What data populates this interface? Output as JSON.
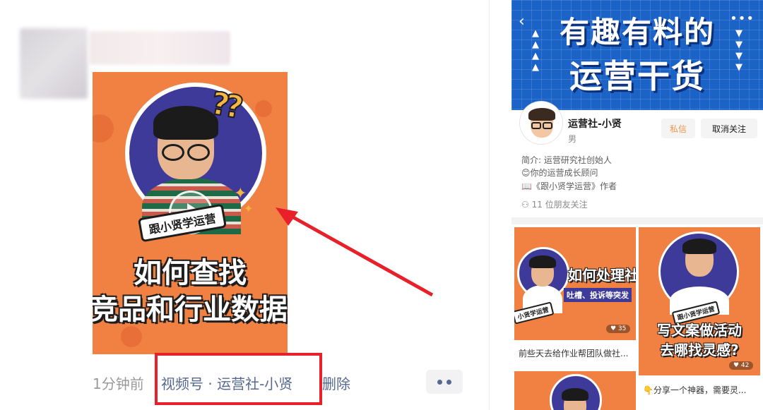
{
  "post": {
    "time": "1分钟前",
    "source": "视频号 · 运营社-小贤",
    "delete": "删除",
    "cover_tag": "跟小贤学运营",
    "cover_title_1": "如何查找",
    "cover_title_2": "竞品和行业数据",
    "cover_qmarks": "??"
  },
  "profile": {
    "banner_line_1": "有趣有料的",
    "banner_line_2": "运营干货",
    "name": "运营社-小贤",
    "gender": "男",
    "message_btn": "私信",
    "unfollow_btn": "取消关注",
    "bio_1": "简介: 运营研究社创始人",
    "bio_2": "😊你的运营成长顾问",
    "bio_3": "📖《跟小贤学运营》作者",
    "friends": "11 位朋友关注"
  },
  "grid": [
    {
      "title": "如何处理社",
      "subtitle": "吐槽、投诉等突发",
      "tag": "小贤学运营",
      "likes": "♥ 35",
      "caption": "前些天去给作业帮团队做社..."
    },
    {
      "title_1": "写文案做活动",
      "title_2": "去哪找灵感?",
      "tag": "跟小贤学运营",
      "likes": "♥ 42",
      "caption": "👇分享一个神器，需要灵..."
    }
  ],
  "colors": {
    "cover_orange": "#f08142",
    "circle_blue": "#3e3a9a",
    "banner_blue": "#1c63c8",
    "link_blue": "#57688f",
    "highlight_red": "#e8202a",
    "message_orange": "#f0954a"
  }
}
